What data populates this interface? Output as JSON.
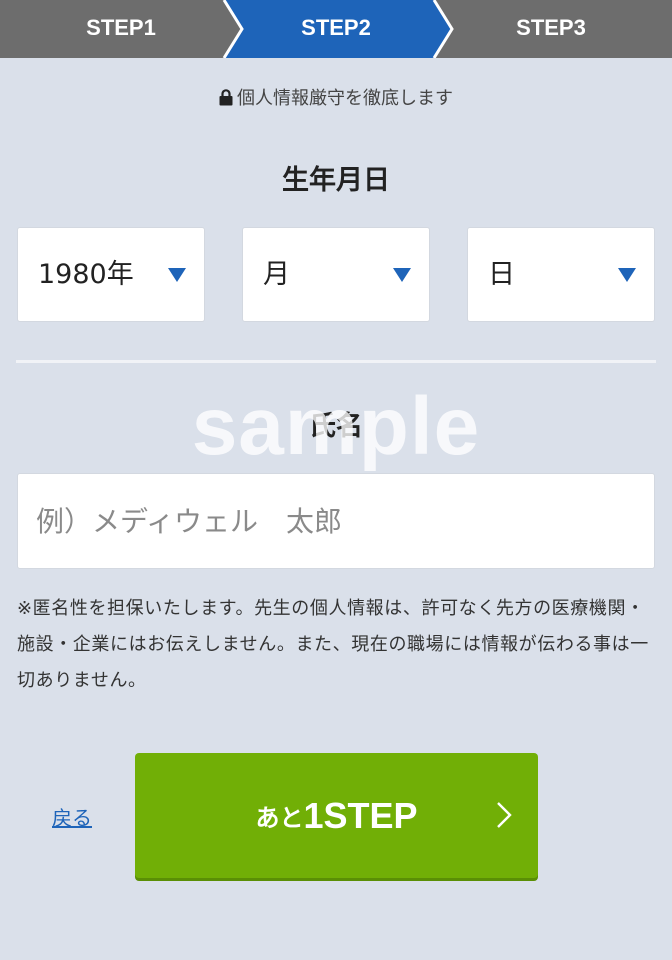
{
  "stepbar": {
    "steps": [
      {
        "label": "STEP1",
        "state": "done"
      },
      {
        "label": "STEP2",
        "state": "current"
      },
      {
        "label": "STEP3",
        "state": "upcoming"
      }
    ],
    "colors": {
      "inactive": "#6d6d6d",
      "active": "#1e64b9",
      "separator": "#ffffff"
    }
  },
  "security_note": {
    "icon": "lock-icon",
    "text": "個人情報厳守を徹底します"
  },
  "birthdate": {
    "title": "生年月日",
    "year": "1980年",
    "month": "月",
    "day": "日",
    "caret_color": "#1e64b9"
  },
  "name": {
    "title": "氏名",
    "placeholder": "例）メディウェル　太郎",
    "value": ""
  },
  "privacy_note": "※匿名性を担保いたします。先生の個人情報は、許可なく先方の医療機関・施設・企業にはお伝えしません。また、現在の職場には情報が伝わる事は一切ありません。",
  "actions": {
    "back_label": "戻る",
    "next_prefix": "あと",
    "next_main": "1STEP",
    "next_color": "#71af06"
  },
  "watermark": "sample"
}
